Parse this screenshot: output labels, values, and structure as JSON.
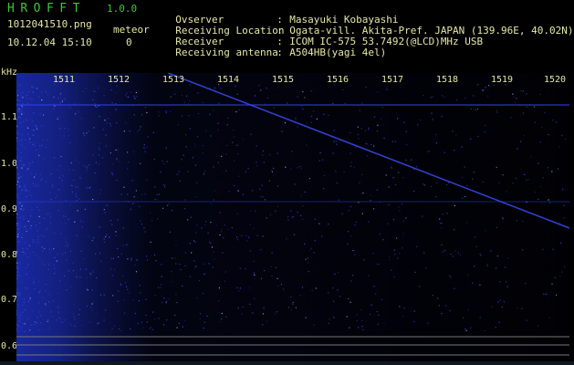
{
  "app": {
    "title": "HROFFT",
    "version": "1.0.0"
  },
  "file": {
    "name": "1012041510.png",
    "datetime": "10.12.04 15:10"
  },
  "meteor": {
    "label": "meteor",
    "count": "0"
  },
  "info": [
    {
      "key": "Ovserver",
      "sep": ":",
      "value": "Masayuki Kobayashi"
    },
    {
      "key": "Receiving Location",
      "sep": ":",
      "value": "Ogata-vill. Akita-Pref. JAPAN (139.96E, 40.02N)"
    },
    {
      "key": "Receiver",
      "sep": ":",
      "value": "ICOM IC-575 53.7492(@LCD)MHz USB"
    },
    {
      "key": "Receiving antenna",
      "sep": ":",
      "value": "A504HB(yagi 4el)"
    }
  ],
  "spectrogram": {
    "y_unit": "kHz",
    "x_ticks": [
      "1511",
      "1512",
      "1513",
      "1514",
      "1515",
      "1516",
      "1517",
      "1518",
      "1519",
      "1520"
    ],
    "y_ticks": [
      "1.1",
      "1.0",
      "0.9",
      "0.8",
      "0.7",
      "0.6"
    ],
    "colors": {
      "signal": "#2f3fe6",
      "noise": "#1a2aa8",
      "text": "#e6e6a8",
      "title": "#3ec43e"
    }
  }
}
